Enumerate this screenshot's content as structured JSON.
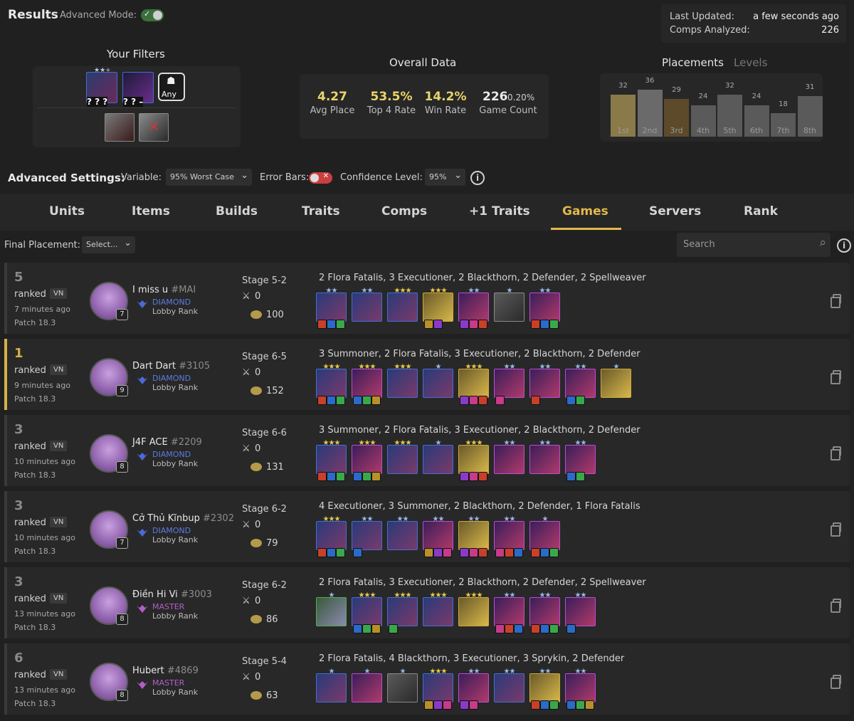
{
  "header": {
    "title": "Results",
    "advanced_mode_label": "Advanced Mode:",
    "last_updated_label": "Last Updated:",
    "last_updated_value": "a few seconds ago",
    "comps_analyzed_label": "Comps Analyzed:",
    "comps_analyzed_value": "226"
  },
  "filters": {
    "title": "Your Filters",
    "any_label": "Any",
    "qmarks_a": "? ? ?",
    "qmarks_b": "? ? –"
  },
  "overall": {
    "title": "Overall Data",
    "avg_place": "4.27",
    "avg_place_label": "Avg Place",
    "top4": "53.5%",
    "top4_label": "Top 4 Rate",
    "win": "14.2%",
    "win_label": "Win Rate",
    "count": "226",
    "count_pct": "0.20%",
    "count_label": "Game Count"
  },
  "placements": {
    "title": "Placements",
    "alt_tab": "Levels",
    "bars": [
      {
        "label": "1st",
        "count": 32,
        "color": "#8a7a4a"
      },
      {
        "label": "2nd",
        "count": 36,
        "color": "#6a6a6a"
      },
      {
        "label": "3rd",
        "count": 29,
        "color": "#5c4a2a"
      },
      {
        "label": "4th",
        "count": 24,
        "color": "#5a5a5a"
      },
      {
        "label": "5th",
        "count": 32,
        "color": "#5a5a5a"
      },
      {
        "label": "6th",
        "count": 24,
        "color": "#5a5a5a"
      },
      {
        "label": "7th",
        "count": 18,
        "color": "#5a5a5a"
      },
      {
        "label": "8th",
        "count": 31,
        "color": "#5a5a5a"
      }
    ]
  },
  "advanced": {
    "title": "Advanced Settings:",
    "variable_label": "Variable:",
    "variable_value": "95% Worst Case",
    "error_bars_label": "Error Bars:",
    "confidence_label": "Confidence Level:",
    "confidence_value": "95%"
  },
  "tabs": [
    "Units",
    "Items",
    "Builds",
    "Traits",
    "Comps",
    "+1 Traits",
    "Games",
    "Servers",
    "Rank"
  ],
  "toolbar": {
    "final_placement_label": "Final Placement:",
    "select_value": "Select...",
    "search_placeholder": "Search"
  },
  "games": [
    {
      "place": "5",
      "mode": "ranked",
      "server": "VN",
      "ago": "7 minutes ago",
      "patch": "Patch 18.3",
      "name": "I miss u",
      "tag": "#MAI",
      "level": "7",
      "rank": "DIAMOND",
      "lobby": "Lobby Rank",
      "stage": "Stage 5-2",
      "kills": "0",
      "gold": "100",
      "traits": "2 Flora Fatalis, 3 Executioner, 2 Blackthorn, 2 Defender, 2 Spellweaver",
      "units": [
        {
          "stars": 2,
          "c": "blue",
          "items": 3
        },
        {
          "stars": 2,
          "c": "blue",
          "items": 0
        },
        {
          "stars": 3,
          "c": "blue",
          "items": 0
        },
        {
          "stars": 3,
          "c": "gold",
          "items": 2
        },
        {
          "stars": 2,
          "c": "purple",
          "items": 3
        },
        {
          "stars": 1,
          "c": "gray",
          "items": 0
        },
        {
          "stars": 2,
          "c": "purple",
          "items": 3
        }
      ]
    },
    {
      "place": "1",
      "mode": "ranked",
      "server": "VN",
      "ago": "9 minutes ago",
      "patch": "Patch 18.3",
      "name": "Dart Dart",
      "tag": "#3105",
      "level": "9",
      "rank": "DIAMOND",
      "lobby": "Lobby Rank",
      "stage": "Stage 6-5",
      "kills": "0",
      "gold": "152",
      "traits": "3 Summoner, 2 Flora Fatalis, 3 Executioner, 2 Blackthorn, 2 Defender",
      "units": [
        {
          "stars": 3,
          "c": "blue",
          "items": 3
        },
        {
          "stars": 3,
          "c": "purple",
          "items": 3
        },
        {
          "stars": 3,
          "c": "blue",
          "items": 0
        },
        {
          "stars": 1,
          "c": "blue",
          "items": 0
        },
        {
          "stars": 3,
          "c": "gold",
          "items": 3
        },
        {
          "stars": 2,
          "c": "purple",
          "items": 1
        },
        {
          "stars": 2,
          "c": "purple",
          "items": 1
        },
        {
          "stars": 2,
          "c": "purple",
          "items": 2
        },
        {
          "stars": 1,
          "c": "gold",
          "items": 0
        }
      ]
    },
    {
      "place": "3",
      "mode": "ranked",
      "server": "VN",
      "ago": "10 minutes ago",
      "patch": "Patch 18.3",
      "name": "J4F ACE",
      "tag": "#2209",
      "level": "8",
      "rank": "DIAMOND",
      "lobby": "Lobby Rank",
      "stage": "Stage 6-6",
      "kills": "0",
      "gold": "131",
      "traits": "3 Summoner, 2 Flora Fatalis, 3 Executioner, 2 Blackthorn, 2 Defender",
      "units": [
        {
          "stars": 3,
          "c": "blue",
          "items": 3
        },
        {
          "stars": 3,
          "c": "purple",
          "items": 3
        },
        {
          "stars": 3,
          "c": "blue",
          "items": 0
        },
        {
          "stars": 1,
          "c": "blue",
          "items": 0
        },
        {
          "stars": 3,
          "c": "gold",
          "items": 3
        },
        {
          "stars": 2,
          "c": "purple",
          "items": 0
        },
        {
          "stars": 2,
          "c": "purple",
          "items": 0
        },
        {
          "stars": 2,
          "c": "purple",
          "items": 2
        }
      ]
    },
    {
      "place": "3",
      "mode": "ranked",
      "server": "VN",
      "ago": "10 minutes ago",
      "patch": "Patch 18.3",
      "name": "Cở Thủ Kĩnbup",
      "tag": "#2302",
      "level": "7",
      "rank": "DIAMOND",
      "lobby": "Lobby Rank",
      "stage": "Stage 6-2",
      "kills": "0",
      "gold": "79",
      "traits": "4 Executioner, 3 Summoner, 2 Blackthorn, 2 Defender, 1 Flora Fatalis",
      "units": [
        {
          "stars": 3,
          "c": "blue",
          "items": 3
        },
        {
          "stars": 2,
          "c": "blue",
          "items": 1
        },
        {
          "stars": 2,
          "c": "blue",
          "items": 0
        },
        {
          "stars": 2,
          "c": "purple",
          "items": 3
        },
        {
          "stars": 2,
          "c": "gold",
          "items": 3
        },
        {
          "stars": 2,
          "c": "purple",
          "items": 3
        },
        {
          "stars": 1,
          "c": "purple",
          "items": 3
        }
      ]
    },
    {
      "place": "3",
      "mode": "ranked",
      "server": "VN",
      "ago": "13 minutes ago",
      "patch": "Patch 18.3",
      "name": "Điền Hi Vi",
      "tag": "#3003",
      "level": "8",
      "rank": "MASTER",
      "lobby": "Lobby Rank",
      "stage": "Stage 6-2",
      "kills": "0",
      "gold": "86",
      "traits": "2 Flora Fatalis, 3 Executioner, 2 Blackthorn, 2 Defender, 2 Spellweaver",
      "units": [
        {
          "stars": 1,
          "c": "green",
          "items": 0
        },
        {
          "stars": 3,
          "c": "blue",
          "items": 3
        },
        {
          "stars": 3,
          "c": "blue",
          "items": 1
        },
        {
          "stars": 3,
          "c": "blue",
          "items": 0
        },
        {
          "stars": 3,
          "c": "gold",
          "items": 0
        },
        {
          "stars": 2,
          "c": "purple",
          "items": 3
        },
        {
          "stars": 2,
          "c": "purple",
          "items": 3
        },
        {
          "stars": 2,
          "c": "purple",
          "items": 1
        }
      ]
    },
    {
      "place": "6",
      "mode": "ranked",
      "server": "VN",
      "ago": "13 minutes ago",
      "patch": "Patch 18.3",
      "name": "Hubert",
      "tag": "#4869",
      "level": "8",
      "rank": "MASTER",
      "lobby": "Lobby Rank",
      "stage": "Stage 5-4",
      "kills": "0",
      "gold": "63",
      "traits": "2 Flora Fatalis, 4 Blackthorn, 3 Executioner, 3 Sprykin, 2 Defender",
      "units": [
        {
          "stars": 1,
          "c": "blue",
          "items": 0
        },
        {
          "stars": 1,
          "c": "purple",
          "items": 0
        },
        {
          "stars": 1,
          "c": "gray",
          "items": 0
        },
        {
          "stars": 3,
          "c": "blue",
          "items": 3
        },
        {
          "stars": 2,
          "c": "purple",
          "items": 2
        },
        {
          "stars": 2,
          "c": "blue",
          "items": 0
        },
        {
          "stars": 2,
          "c": "gold",
          "items": 3
        },
        {
          "stars": 2,
          "c": "purple",
          "items": 3
        }
      ]
    }
  ]
}
